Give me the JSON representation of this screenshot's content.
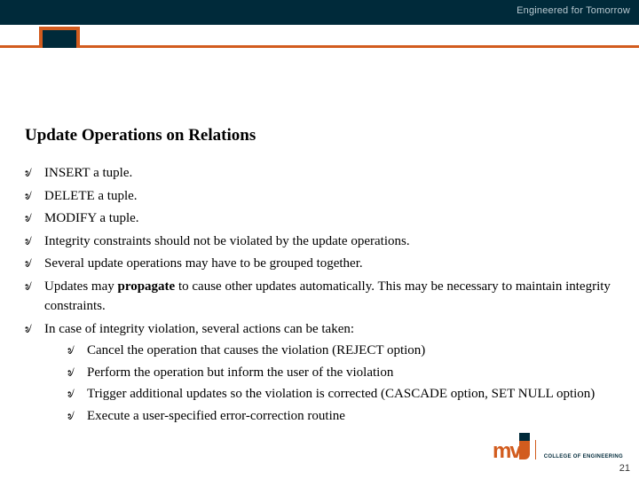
{
  "header": {
    "tagline": "Engineered for Tomorrow"
  },
  "title": "Update Operations on Relations",
  "bullet_marker": "৶",
  "items": [
    {
      "text": "INSERT a tuple."
    },
    {
      "text": "DELETE a tuple."
    },
    {
      "text": "MODIFY a tuple."
    },
    {
      "text": "Integrity constraints should not be violated by the update operations."
    },
    {
      "text": "Several update operations may have to be grouped together."
    },
    {
      "pre": "Updates may ",
      "bold": "propagate",
      "post": " to cause other updates automatically. This may be necessary to maintain integrity constraints."
    },
    {
      "text": "In case of integrity violation, several actions can be taken:",
      "sub": [
        "Cancel the operation that causes the violation (REJECT option)",
        "Perform the operation but inform the user of the violation",
        "Trigger additional updates so the violation is corrected (CASCADE option, SET NULL option)",
        "Execute a user-specified error-correction routine"
      ]
    }
  ],
  "footer": {
    "page_number": "21",
    "logo": {
      "brand_text": "COLLEGE OF\nENGINEERING"
    }
  }
}
